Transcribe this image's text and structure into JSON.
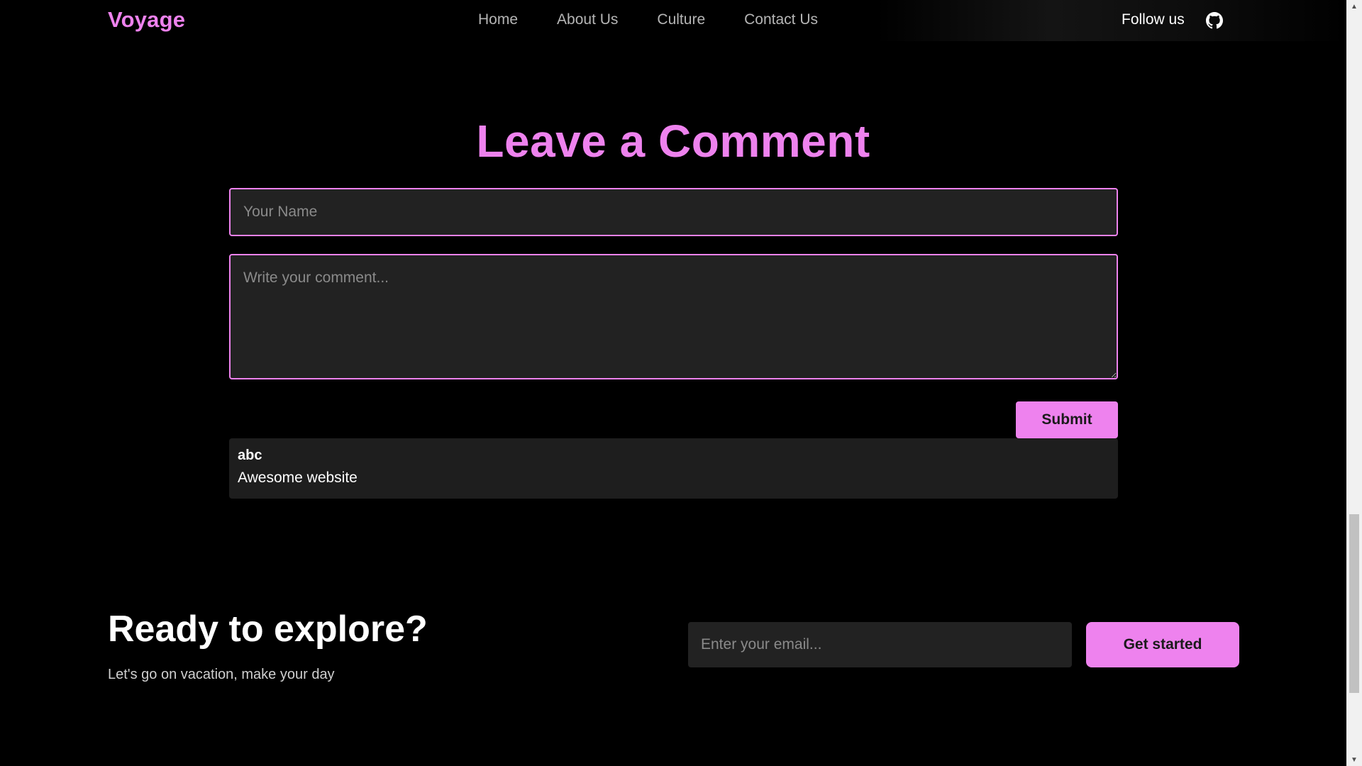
{
  "header": {
    "logo": "Voyage",
    "nav": [
      "Home",
      "About Us",
      "Culture",
      "Contact Us"
    ],
    "follow_label": "Follow us",
    "social_icon": "github-icon"
  },
  "comment_section": {
    "title": "Leave a Comment",
    "name_placeholder": "Your Name",
    "comment_placeholder": "Write your comment...",
    "submit_label": "Submit",
    "comments": [
      {
        "author": "abc",
        "text": "Awesome website"
      }
    ]
  },
  "cta": {
    "title": "Ready to explore?",
    "subtitle": "Let's go on vacation, make your day",
    "email_placeholder": "Enter your email...",
    "button_label": "Get started"
  },
  "colors": {
    "accent": "#ee82ee",
    "background": "#000000",
    "field": "#222222"
  }
}
